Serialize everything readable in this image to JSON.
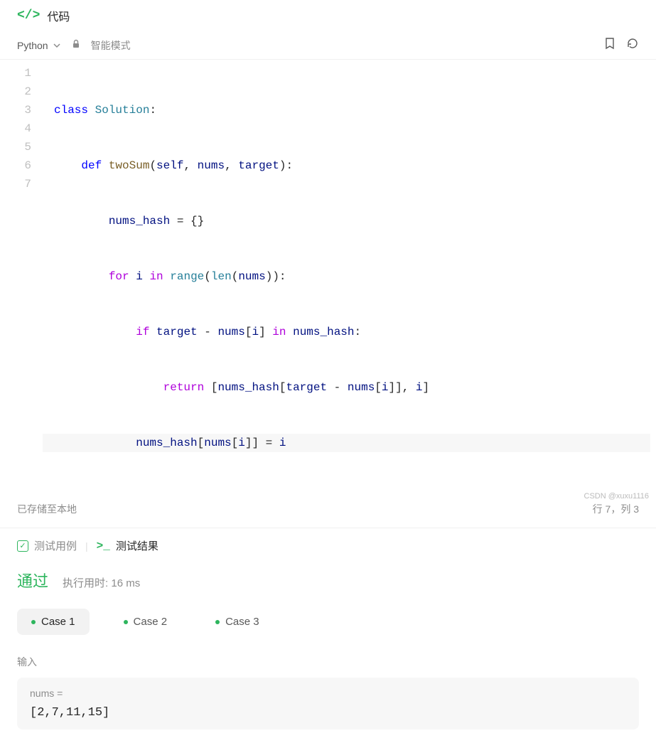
{
  "header": {
    "title": "代码"
  },
  "toolbar": {
    "language": "Python",
    "mode": "智能模式"
  },
  "code": {
    "line_numbers": [
      "1",
      "2",
      "3",
      "4",
      "5",
      "6",
      "7"
    ]
  },
  "status": {
    "saved": "已存储至本地",
    "position": "行 7，列 3"
  },
  "tabs": {
    "testcases": "测试用例",
    "results": "测试结果"
  },
  "result": {
    "pass": "通过",
    "time": "执行用时: 16 ms"
  },
  "cases": [
    {
      "label": "Case 1"
    },
    {
      "label": "Case 2"
    },
    {
      "label": "Case 3"
    }
  ],
  "input": {
    "label": "输入",
    "var": "nums =",
    "value": "[2,7,11,15]"
  },
  "watermark": "CSDN @xuxu1116"
}
